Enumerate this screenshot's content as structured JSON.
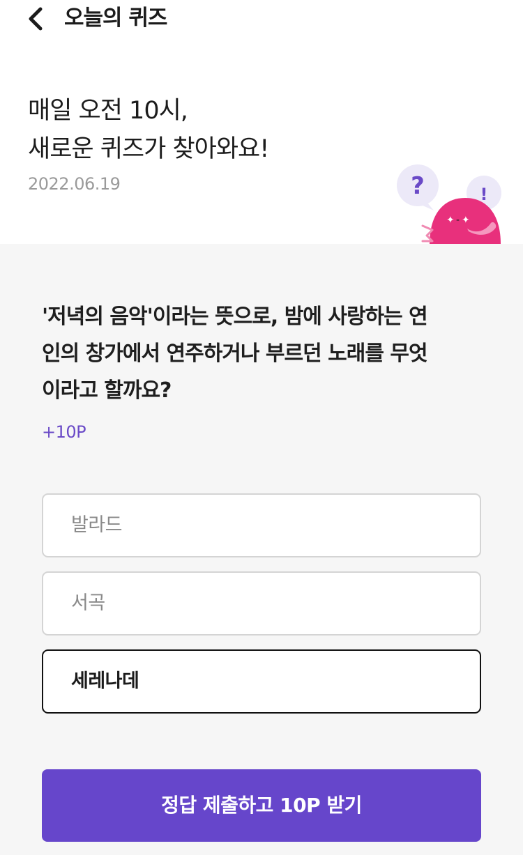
{
  "header": {
    "title": "오늘의 퀴즈",
    "back_icon": "chevron-left-icon"
  },
  "intro": {
    "line1": "매일 오전 10시,",
    "line2": "새로운 퀴즈가 찾아와요!",
    "date": "2022.06.19"
  },
  "mascot": {
    "question_mark": "?",
    "exclamation_mark": "!",
    "body_color": "#e8307c",
    "bubble_color": "#ece9f8",
    "mark_color": "#6a4ac7"
  },
  "quiz": {
    "question_line1": "'저녁의 음악'이라는 뜻으로, 밤에 사랑하는 연",
    "question_line2": "인의 창가에서 연주하거나 부르던 노래를 무엇",
    "question_line3": "이라고 할까요?",
    "points": "+10P",
    "options": [
      {
        "label": "발라드",
        "selected": false
      },
      {
        "label": "서곡",
        "selected": false
      },
      {
        "label": "세레나데",
        "selected": true
      }
    ]
  },
  "submit": {
    "label": "정답 제출하고 10P 받기"
  },
  "colors": {
    "accent": "#6646cb",
    "points_text": "#6a4ac7",
    "background": "#f6f6f6"
  }
}
